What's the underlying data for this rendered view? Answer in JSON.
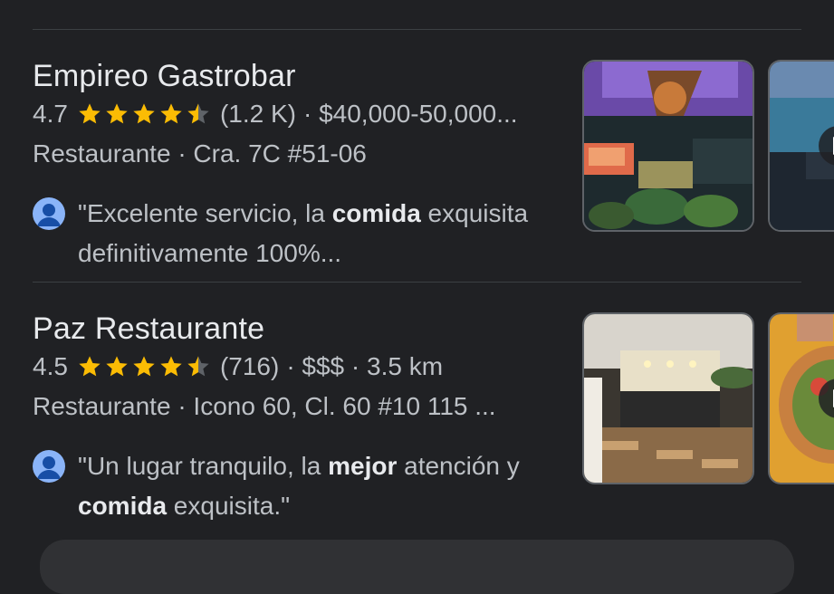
{
  "results": [
    {
      "name": "Empireo Gastrobar",
      "rating": "4.7",
      "rating_value": 4.7,
      "review_count": "(1.2 K)",
      "price": "· $40,000-50,000...",
      "address": "Restaurante · Cra. 7C #51-06",
      "review_parts": [
        "\"Excelente servicio, la ",
        "comida",
        " exquisita definitivamente 100%..."
      ],
      "photo_icons": [
        "restaurant-photo",
        "video-thumbnail"
      ]
    },
    {
      "name": "Paz Restaurante",
      "rating": "4.5",
      "rating_value": 4.5,
      "review_count": "(716)",
      "price": "· $$$ · 3.5 km",
      "address": "Restaurante · Icono 60, Cl. 60 #10 115 ...",
      "review_parts": [
        "\"Un lugar tranquilo, la ",
        "mejor",
        " atención y ",
        "comida",
        " exquisita.\""
      ],
      "photo_icons": [
        "restaurant-photo",
        "video-thumbnail"
      ]
    }
  ],
  "colors": {
    "star": "#fbbc04",
    "background": "#202124",
    "avatar": "#8ab4f8"
  }
}
